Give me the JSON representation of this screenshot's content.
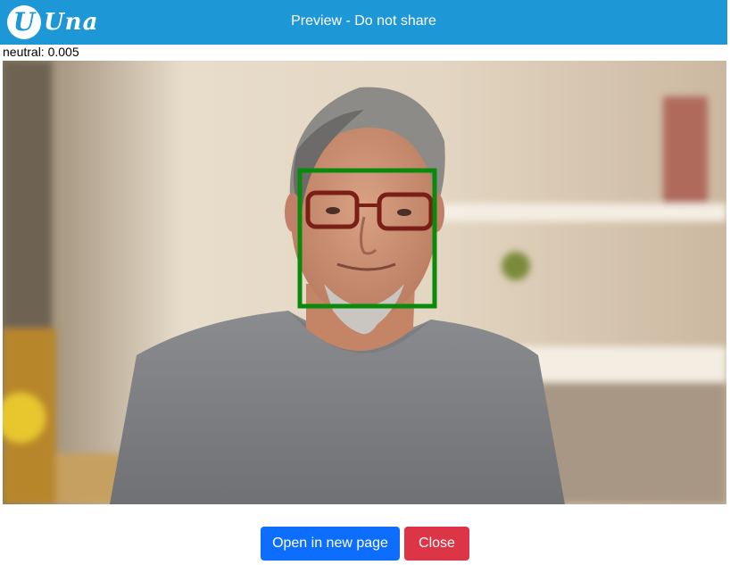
{
  "header": {
    "logo_letter": "U",
    "logo_text": "Una",
    "title": "Preview - Do not share",
    "background_color": "#1d97d6"
  },
  "result": {
    "label": "neutral: 0.005"
  },
  "photo": {
    "description_icon": "face-detection-photo",
    "box_color": "#0a8a0a"
  },
  "actions": {
    "open_label": "Open in new page",
    "close_label": "Close",
    "open_color": "#0d6efd",
    "close_color": "#dc3545"
  }
}
